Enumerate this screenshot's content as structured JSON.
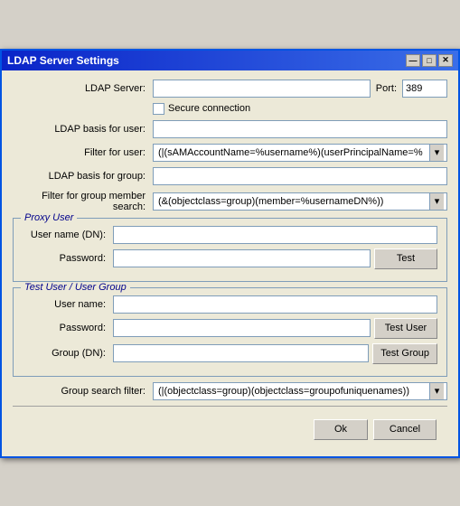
{
  "window": {
    "title": "LDAP Server Settings",
    "close_btn": "✕",
    "minimize_btn": "—",
    "maximize_btn": "□"
  },
  "form": {
    "ldap_server_label": "LDAP Server:",
    "ldap_server_value": "",
    "port_label": "Port:",
    "port_value": "389",
    "secure_label": "Secure connection",
    "ldap_basis_user_label": "LDAP basis for user:",
    "ldap_basis_user_value": "",
    "filter_user_label": "Filter for user:",
    "filter_user_value": "(|(sAMAccountName=%username%)(userPrincipalName=%",
    "ldap_basis_group_label": "LDAP basis for group:",
    "ldap_basis_group_value": "",
    "filter_group_label": "Filter for group member search:",
    "filter_group_value": "(&(objectclass=group)(member=%usernameDN%))"
  },
  "proxy_user": {
    "title": "Proxy User",
    "username_label": "User name (DN):",
    "username_value": "",
    "password_label": "Password:",
    "password_value": "",
    "test_btn": "Test"
  },
  "test_section": {
    "title": "Test User / User Group",
    "username_label": "User name:",
    "username_value": "",
    "password_label": "Password:",
    "password_value": "",
    "test_user_btn": "Test User",
    "group_label": "Group (DN):",
    "group_value": "",
    "test_group_btn": "Test Group"
  },
  "bottom": {
    "group_search_label": "Group search filter:",
    "group_search_value": "(|(objectclass=group)(objectclass=groupofuniquenames))",
    "ok_btn": "Ok",
    "cancel_btn": "Cancel"
  }
}
